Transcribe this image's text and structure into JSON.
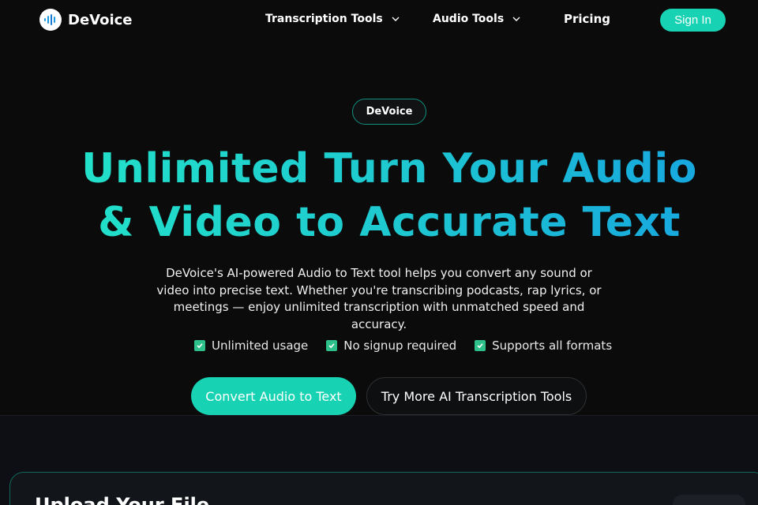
{
  "brand": {
    "name": "DeVoice",
    "icon": "soundwave-icon"
  },
  "nav": {
    "items": [
      {
        "label": "Transcription Tools",
        "icon": "chevron-down-icon"
      },
      {
        "label": "Audio Tools",
        "icon": "chevron-down-icon"
      },
      {
        "label": "Pricing"
      }
    ],
    "signin_label": "Sign In"
  },
  "hero": {
    "badge": "DeVoice",
    "headline_line1": "Unlimited Turn Your Audio",
    "headline_line2": "& Video to Accurate Text",
    "description": "DeVoice's AI-powered Audio to Text tool helps you convert any sound or video into precise text. Whether you're transcribing podcasts, rap lyrics, or meetings — enjoy unlimited transcription with unmatched speed and accuracy.",
    "features": [
      "Unlimited usage",
      "No signup required",
      "Supports all formats"
    ],
    "primary_cta": "Convert Audio to Text",
    "secondary_cta": "Try More AI Transcription Tools"
  },
  "upload": {
    "title": "Upload Your File"
  },
  "colors": {
    "accent": "#17d3b4",
    "gradient_start": "#22e3c8",
    "gradient_end": "#16a4e0",
    "check": "#2ec08a",
    "background": "#0b0b0c"
  }
}
